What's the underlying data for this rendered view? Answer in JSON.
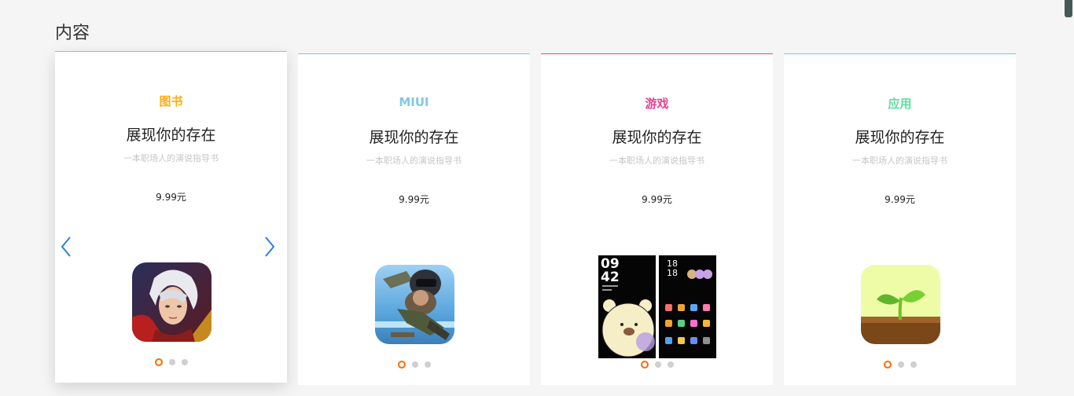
{
  "section": {
    "title": "内容"
  },
  "colors": {
    "book": "#ffac13",
    "miui": "#83c7e4",
    "game": "#e9418f",
    "app": "#5ee0a0",
    "dot_active": "#ff6a00"
  },
  "cards": [
    {
      "category": "图书",
      "title": "展现你的存在",
      "desc": "一本职场人的演说指导书",
      "price": "9.99元",
      "icon": "game-hero-app-icon"
    },
    {
      "category": "MIUI",
      "title": "展现你的存在",
      "desc": "一本职场人的演说指导书",
      "price": "9.99元",
      "icon": "soldier-game-app-icon"
    },
    {
      "category": "游戏",
      "title": "展现你的存在",
      "desc": "一本职场人的演说指导书",
      "price": "9.99元",
      "icon": "bear-theme-screens"
    },
    {
      "category": "应用",
      "title": "展现你的存在",
      "desc": "一本职场人的演说指导书",
      "price": "9.99元",
      "icon": "sprout-app-icon"
    }
  ],
  "theme_preview": {
    "left": {
      "time_hour": "09",
      "time_min": "42"
    },
    "right": {
      "time_hour": "18",
      "time_min": "18"
    }
  }
}
